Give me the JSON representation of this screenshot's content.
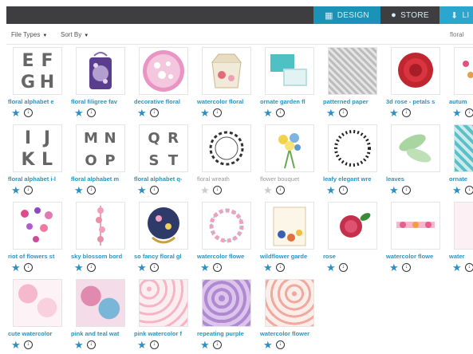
{
  "nav": {
    "tabs": [
      {
        "label": "DESIGN",
        "icon": "grid-icon"
      },
      {
        "label": "STORE",
        "icon": "store-icon"
      },
      {
        "label": "LI",
        "icon": "download-icon"
      }
    ]
  },
  "filters": {
    "file_types": "File Types",
    "sort_by": "Sort By",
    "search_value": "floral"
  },
  "items": [
    {
      "name": "floral alphabet e",
      "letters": "EFGH",
      "starred": true
    },
    {
      "name": "floral filigree fav",
      "starred": true
    },
    {
      "name": "decorative floral",
      "starred": true
    },
    {
      "name": "watercolor floral",
      "starred": true
    },
    {
      "name": "ornate garden fl",
      "starred": true
    },
    {
      "name": "patterned paper",
      "starred": true
    },
    {
      "name": "3d rose - petals s",
      "starred": true
    },
    {
      "name": "autum",
      "starred": true
    },
    {
      "name": "floral alphabet i-l",
      "letters": "IJKL",
      "starred": true
    },
    {
      "name": "floral alphabet m",
      "letters": "MNOP",
      "starred": true
    },
    {
      "name": "floral alphabet q-",
      "letters": "QRST",
      "starred": true
    },
    {
      "name": "floral wreath",
      "starred": false
    },
    {
      "name": "flower bouquet",
      "starred": false
    },
    {
      "name": "leafy elegant wre",
      "starred": true
    },
    {
      "name": "leaves",
      "starred": true
    },
    {
      "name": "ornate",
      "starred": true
    },
    {
      "name": "riot of flowers st",
      "starred": true
    },
    {
      "name": "sky blossom bord",
      "starred": true
    },
    {
      "name": "so fancy floral gl",
      "starred": true
    },
    {
      "name": "watercolor flowe",
      "starred": true
    },
    {
      "name": "wildflower garde",
      "starred": true
    },
    {
      "name": "rose",
      "starred": true
    },
    {
      "name": "watercolor flowe",
      "starred": true
    },
    {
      "name": "water",
      "starred": true
    },
    {
      "name": "cute watercolor",
      "starred": true
    },
    {
      "name": "pink and teal wat",
      "starred": true
    },
    {
      "name": "pink watercolor f",
      "starred": true
    },
    {
      "name": "repeating purple",
      "starred": true
    },
    {
      "name": "watercolor flower",
      "starred": true
    }
  ]
}
